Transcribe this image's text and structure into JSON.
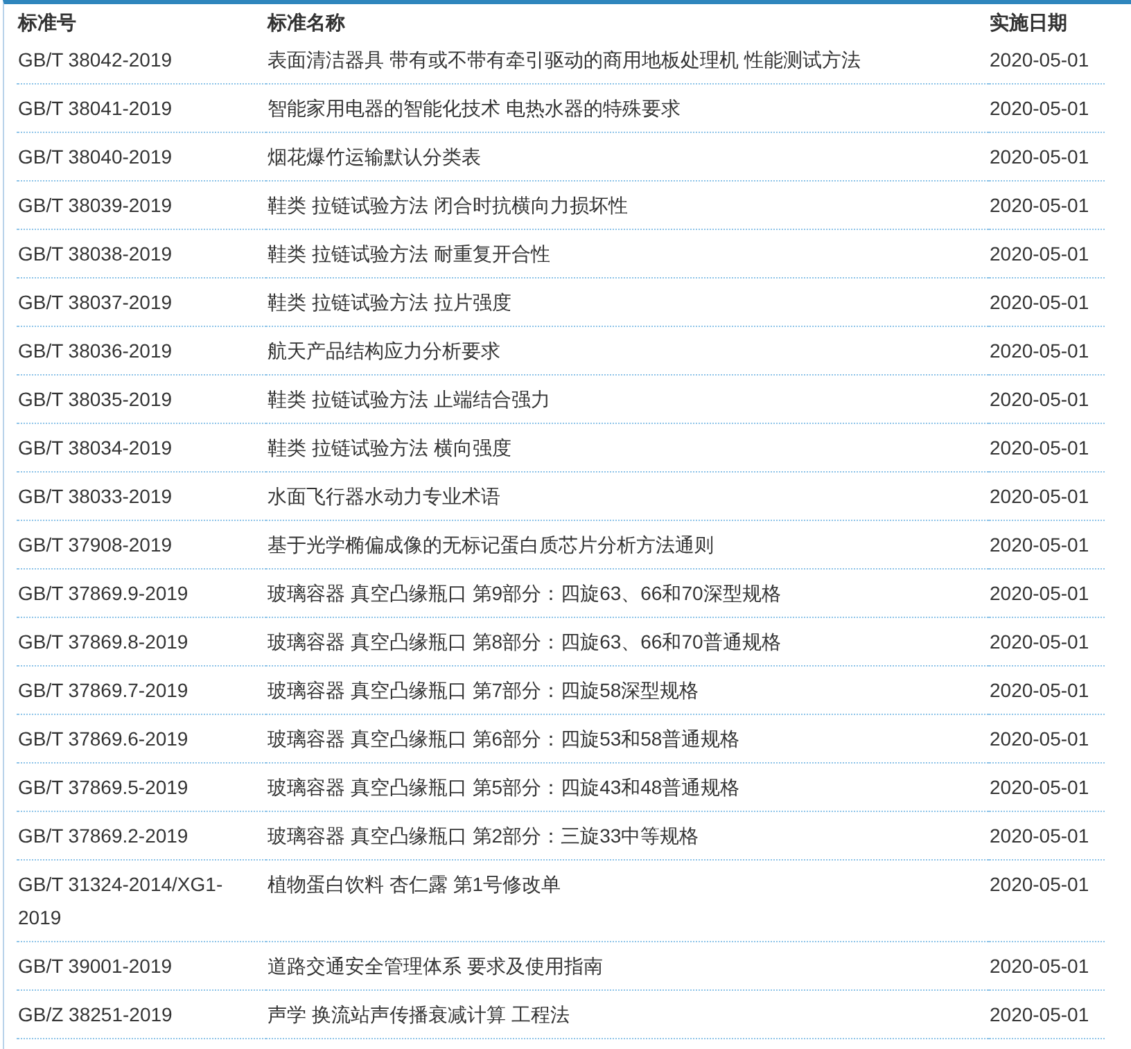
{
  "table": {
    "columns": [
      "标准号",
      "标准名称",
      "实施日期"
    ],
    "rows": [
      {
        "number": "GB/T 38042-2019",
        "name": "表面清洁器具 带有或不带有牵引驱动的商用地板处理机 性能测试方法",
        "date": "2020-05-01"
      },
      {
        "number": "GB/T 38041-2019",
        "name": "智能家用电器的智能化技术 电热水器的特殊要求",
        "date": "2020-05-01"
      },
      {
        "number": "GB/T 38040-2019",
        "name": "烟花爆竹运输默认分类表",
        "date": "2020-05-01"
      },
      {
        "number": "GB/T 38039-2019",
        "name": "鞋类 拉链试验方法 闭合时抗横向力损坏性",
        "date": "2020-05-01"
      },
      {
        "number": "GB/T 38038-2019",
        "name": "鞋类 拉链试验方法 耐重复开合性",
        "date": "2020-05-01"
      },
      {
        "number": "GB/T 38037-2019",
        "name": "鞋类 拉链试验方法 拉片强度",
        "date": "2020-05-01"
      },
      {
        "number": "GB/T 38036-2019",
        "name": "航天产品结构应力分析要求",
        "date": "2020-05-01"
      },
      {
        "number": "GB/T 38035-2019",
        "name": "鞋类 拉链试验方法 止端结合强力",
        "date": "2020-05-01"
      },
      {
        "number": "GB/T 38034-2019",
        "name": "鞋类 拉链试验方法 横向强度",
        "date": "2020-05-01"
      },
      {
        "number": "GB/T 38033-2019",
        "name": "水面飞行器水动力专业术语",
        "date": "2020-05-01"
      },
      {
        "number": "GB/T 37908-2019",
        "name": "基于光学椭偏成像的无标记蛋白质芯片分析方法通则",
        "date": "2020-05-01"
      },
      {
        "number": "GB/T 37869.9-2019",
        "name": "玻璃容器 真空凸缘瓶口 第9部分：四旋63、66和70深型规格",
        "date": "2020-05-01"
      },
      {
        "number": "GB/T 37869.8-2019",
        "name": "玻璃容器 真空凸缘瓶口 第8部分：四旋63、66和70普通规格",
        "date": "2020-05-01"
      },
      {
        "number": "GB/T 37869.7-2019",
        "name": "玻璃容器 真空凸缘瓶口 第7部分：四旋58深型规格",
        "date": "2020-05-01"
      },
      {
        "number": "GB/T 37869.6-2019",
        "name": "玻璃容器 真空凸缘瓶口 第6部分：四旋53和58普通规格",
        "date": "2020-05-01"
      },
      {
        "number": "GB/T 37869.5-2019",
        "name": "玻璃容器 真空凸缘瓶口 第5部分：四旋43和48普通规格",
        "date": "2020-05-01"
      },
      {
        "number": "GB/T 37869.2-2019",
        "name": "玻璃容器 真空凸缘瓶口 第2部分：三旋33中等规格",
        "date": "2020-05-01"
      },
      {
        "number": "GB/T 31324-2014/XG1-2019",
        "name": "植物蛋白饮料 杏仁露 第1号修改单",
        "date": "2020-05-01"
      },
      {
        "number": "GB/T 39001-2019",
        "name": "道路交通安全管理体系 要求及使用指南",
        "date": "2020-05-01"
      },
      {
        "number": "GB/Z 38251-2019",
        "name": "声学 换流站声传播衰减计算 工程法",
        "date": "2020-05-01"
      }
    ]
  }
}
